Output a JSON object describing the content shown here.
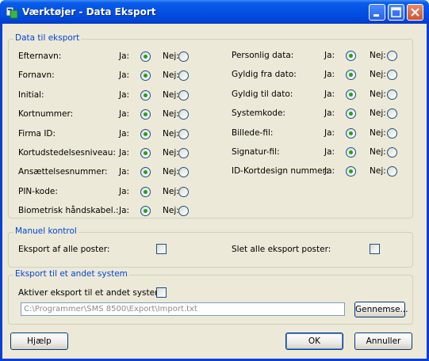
{
  "window": {
    "title": "Værktøjer - Data Eksport"
  },
  "groups": {
    "data_til_eksport": "Data til eksport",
    "manuel_kontrol": "Manuel kontrol",
    "eksport_andet_system": "Eksport til et andet system"
  },
  "options": {
    "yes": "Ja:",
    "no": "Nej:"
  },
  "fields_left": [
    {
      "label": "Efternavn:",
      "selected": "Ja"
    },
    {
      "label": "Fornavn:",
      "selected": "Ja"
    },
    {
      "label": "Initial:",
      "selected": "Ja"
    },
    {
      "label": "Kortnummer:",
      "selected": "Ja"
    },
    {
      "label": "Firma ID:",
      "selected": "Ja"
    },
    {
      "label": "Kortudstedelsesniveau:",
      "selected": "Ja"
    },
    {
      "label": "Ansættelsesnummer:",
      "selected": "Ja"
    },
    {
      "label": "PIN-kode:",
      "selected": "Ja"
    },
    {
      "label": "Biometrisk håndskabel.:",
      "selected": "Ja"
    }
  ],
  "fields_right": [
    {
      "label": "Personlig data:",
      "selected": "Ja"
    },
    {
      "label": "Gyldig fra dato:",
      "selected": "Ja"
    },
    {
      "label": "Gyldig til dato:",
      "selected": "Ja"
    },
    {
      "label": "Systemkode:",
      "selected": "Ja"
    },
    {
      "label": "Billede-fil:",
      "selected": "Ja"
    },
    {
      "label": "Signatur-fil:",
      "selected": "Ja"
    },
    {
      "label": "ID-Kortdesign nummer:",
      "selected": "Ja"
    }
  ],
  "manual": {
    "export_all_label": "Eksport af alle poster:",
    "export_all_checked": false,
    "delete_all_label": "Slet alle eksport poster:",
    "delete_all_checked": false
  },
  "external": {
    "activate_label": "Aktiver eksport til et andet system",
    "activate_checked": false,
    "path_value": "C:\\Programmer\\SMS 8500\\Export\\Import.txt",
    "browse_label": "Gennemse..."
  },
  "buttons": {
    "help": "Hjælp",
    "ok": "OK",
    "cancel": "Annuller"
  },
  "colors": {
    "group_title": "#0046d5",
    "radio_dot": "#21a121",
    "titlebar": "#0553e6"
  }
}
